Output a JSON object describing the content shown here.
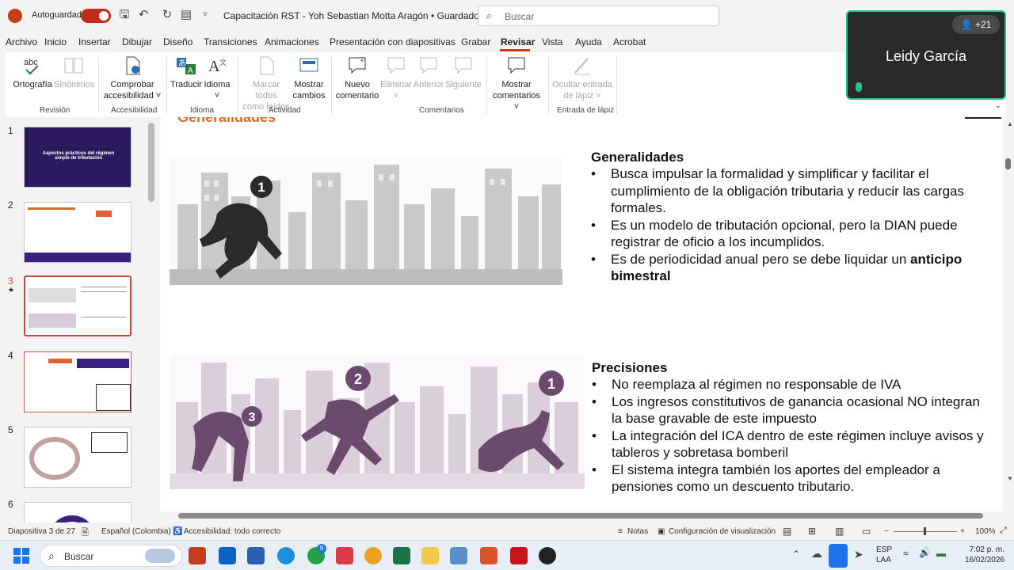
{
  "titlebar": {
    "autosave_label": "Autoguardado",
    "doc_title": "Capacitación RST - Yoh Sebastian Motta Aragón • Guardado",
    "search_placeholder": "Buscar"
  },
  "menu": [
    "Archivo",
    "Inicio",
    "Insertar",
    "Dibujar",
    "Diseño",
    "Transiciones",
    "Animaciones",
    "Presentación con diapositivas",
    "Grabar",
    "Revisar",
    "Vista",
    "Ayuda",
    "Acrobat"
  ],
  "ribbon": {
    "buttons": [
      {
        "label1": "Ortografía",
        "label2": "",
        "icon": "spelling-icon"
      },
      {
        "label1": "Sinónimos",
        "label2": "",
        "icon": "thesaurus-icon",
        "disabled": true
      },
      {
        "label1": "Comprobar",
        "label2": "accesibilidad ˅",
        "icon": "accessibility-icon"
      },
      {
        "label1": "Traducir",
        "label2": "",
        "icon": "translate-icon"
      },
      {
        "label1": "Idioma",
        "label2": "˅",
        "icon": "language-icon"
      },
      {
        "label1": "Marcar todos",
        "label2": "como leídos",
        "icon": "mark-read-icon",
        "disabled": true
      },
      {
        "label1": "Mostrar",
        "label2": "cambios",
        "icon": "show-changes-icon"
      },
      {
        "label1": "Nuevo",
        "label2": "comentario",
        "icon": "new-comment-icon"
      },
      {
        "label1": "Eliminar",
        "label2": "˅",
        "icon": "delete-comment-icon",
        "disabled": true
      },
      {
        "label1": "Anterior",
        "label2": "",
        "icon": "previous-comment-icon",
        "disabled": true
      },
      {
        "label1": "Siguiente",
        "label2": "",
        "icon": "next-comment-icon",
        "disabled": true
      },
      {
        "label1": "Mostrar",
        "label2": "comentarios ˅",
        "icon": "show-comments-icon"
      },
      {
        "label1": "Ocultar entrada",
        "label2": "de lápiz ˅",
        "icon": "ink-icon",
        "disabled": true
      }
    ],
    "groups": [
      "Revisión",
      "Accesibilidad",
      "Idioma",
      "Actividad",
      "Comentarios",
      "Entrada de lápiz"
    ]
  },
  "video": {
    "name": "Leidy García",
    "participants": "+21"
  },
  "thumbnails": [
    {
      "num": "1",
      "title": "Aspectos prácticos del régimen simple de tributación"
    },
    {
      "num": "2"
    },
    {
      "num": "3",
      "star": "★"
    },
    {
      "num": "4"
    },
    {
      "num": "5"
    },
    {
      "num": "6"
    }
  ],
  "slide": {
    "heading": "Generalidades",
    "section1": {
      "title": "Generalidades",
      "bullets": [
        "Busca impulsar la formalidad y simplificar y facilitar el cumplimiento de la obligación tributaria y reducir las cargas formales.",
        "Es un modelo de tributación opcional, pero la DIAN puede registrar de oficio a los incumplidos.",
        "Es de periodicidad anual pero se debe liquidar un "
      ],
      "bold_tail": "anticipo bimestral"
    },
    "section2": {
      "title": "Precisiones",
      "bullets": [
        "No reemplaza al régimen no responsable de IVA",
        "Los ingresos constitutivos de ganancia ocasional NO integran la base gravable de este impuesto",
        "La integración del ICA dentro de este régimen incluye avisos y tableros y sobretasa bomberil",
        "El sistema integra también los aportes del empleador a pensiones como un descuento tributario."
      ]
    },
    "figure_numbers": [
      "1",
      "3",
      "2",
      "1"
    ]
  },
  "status": {
    "slide_info": "Diapositiva 3 de 27",
    "language": "Español (Colombia)",
    "accessibility": "Accesibilidad: todo correcto",
    "notes": "Notas",
    "view_settings": "Configuración de visualización",
    "zoom": "100%"
  },
  "taskbar": {
    "search": "Buscar",
    "lang1": "ESP",
    "lang2": "LAA",
    "time": "7:02 p. m.",
    "date": "16/02/2026",
    "badge": "9"
  },
  "colors": {
    "accent": "#c43e1c",
    "purple": "#6b4a6e",
    "grey_figure": "#3a3a3a",
    "video_border": "#25c28a"
  }
}
